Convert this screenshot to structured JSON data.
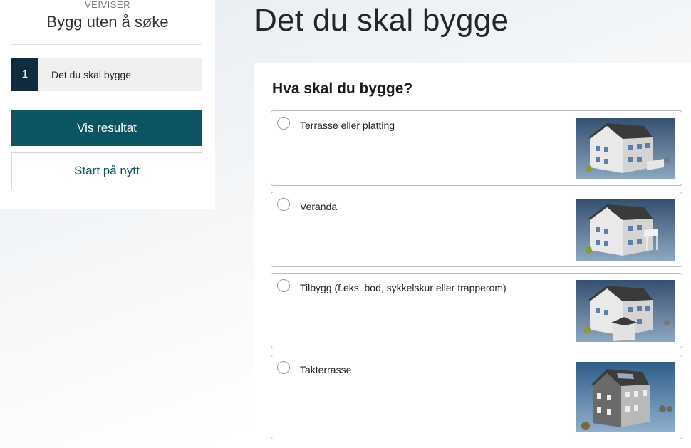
{
  "sidebar": {
    "eyebrow": "VEIVISER",
    "title": "Bygg uten å søke",
    "steps": [
      {
        "number": "1",
        "label": "Det du skal bygge"
      }
    ],
    "primary_button": "Vis resultat",
    "secondary_button": "Start på nytt"
  },
  "main": {
    "page_title": "Det du skal bygge",
    "question": "Hva skal du bygge?",
    "options": [
      {
        "label": "Terrasse eller platting",
        "image_icon": "house-terrace-icon"
      },
      {
        "label": "Veranda",
        "image_icon": "house-veranda-icon"
      },
      {
        "label": "Tilbygg (f.eks. bod, sykkelskur eller trapperom)",
        "image_icon": "house-annex-icon"
      },
      {
        "label": "Takterrasse",
        "image_icon": "house-roof-terrace-icon"
      }
    ]
  },
  "colors": {
    "primary": "#0b5563",
    "step_badge": "#0f2b3d",
    "image_bg": "#5a7494"
  }
}
